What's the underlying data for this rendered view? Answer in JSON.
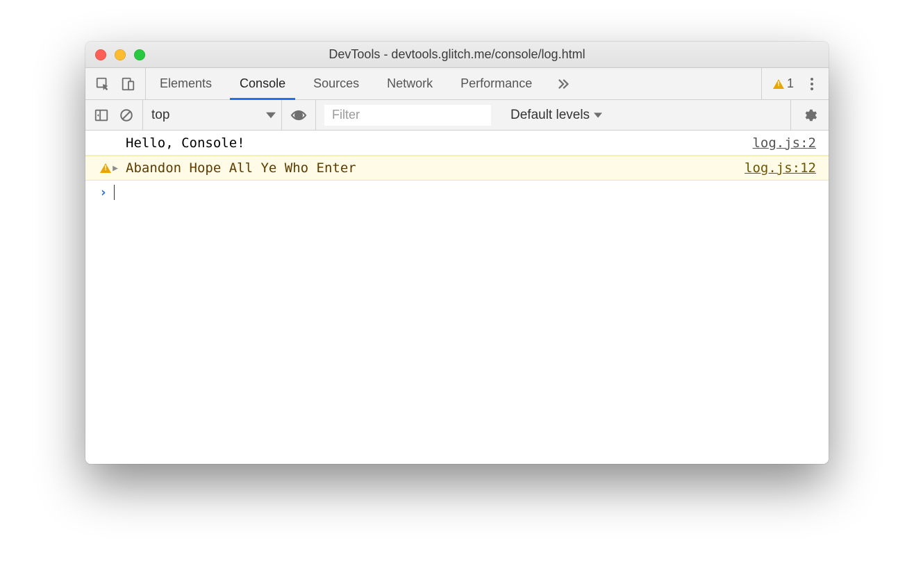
{
  "window": {
    "title": "DevTools - devtools.glitch.me/console/log.html"
  },
  "tabs": {
    "items": [
      {
        "label": "Elements"
      },
      {
        "label": "Console"
      },
      {
        "label": "Sources"
      },
      {
        "label": "Network"
      },
      {
        "label": "Performance"
      }
    ],
    "active_index": 1,
    "warning_count": "1"
  },
  "toolbar": {
    "context": "top",
    "filter_placeholder": "Filter",
    "levels_label": "Default levels"
  },
  "logs": [
    {
      "kind": "log",
      "message": "Hello, Console!",
      "source": "log.js:2",
      "expandable": false
    },
    {
      "kind": "warn",
      "message": "Abandon Hope All Ye Who Enter",
      "source": "log.js:12",
      "expandable": true
    }
  ]
}
